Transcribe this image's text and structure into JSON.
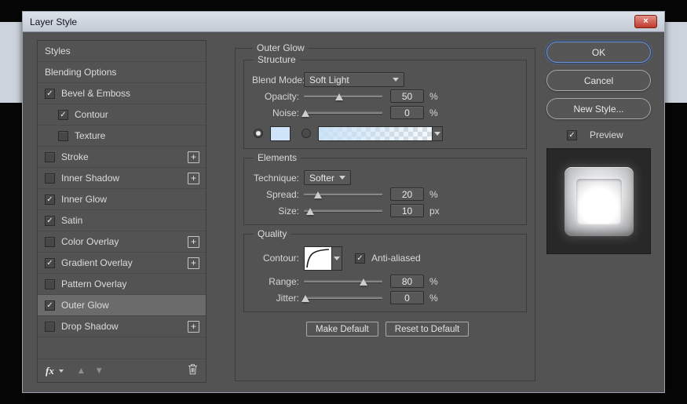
{
  "window": {
    "title": "Layer Style",
    "close_glyph": "×"
  },
  "colors": {
    "ok_focus_ring": "#6f94de",
    "glow_swatch": "#cfe4f8",
    "titlebar": "#c9d1db"
  },
  "sidebar": {
    "items": [
      {
        "label": "Styles",
        "checkbox": "none",
        "checked": false,
        "indent": false,
        "plus": false,
        "selected": false
      },
      {
        "label": "Blending Options",
        "checkbox": "none",
        "checked": false,
        "indent": false,
        "plus": false,
        "selected": false
      },
      {
        "label": "Bevel & Emboss",
        "checkbox": "box",
        "checked": true,
        "indent": false,
        "plus": false,
        "selected": false
      },
      {
        "label": "Contour",
        "checkbox": "box",
        "checked": true,
        "indent": true,
        "plus": false,
        "selected": false
      },
      {
        "label": "Texture",
        "checkbox": "box",
        "checked": false,
        "indent": true,
        "plus": false,
        "selected": false
      },
      {
        "label": "Stroke",
        "checkbox": "box",
        "checked": false,
        "indent": false,
        "plus": true,
        "selected": false
      },
      {
        "label": "Inner Shadow",
        "checkbox": "box",
        "checked": false,
        "indent": false,
        "plus": true,
        "selected": false
      },
      {
        "label": "Inner Glow",
        "checkbox": "box",
        "checked": true,
        "indent": false,
        "plus": false,
        "selected": false
      },
      {
        "label": "Satin",
        "checkbox": "box",
        "checked": true,
        "indent": false,
        "plus": false,
        "selected": false
      },
      {
        "label": "Color Overlay",
        "checkbox": "box",
        "checked": false,
        "indent": false,
        "plus": true,
        "selected": false
      },
      {
        "label": "Gradient Overlay",
        "checkbox": "box",
        "checked": true,
        "indent": false,
        "plus": true,
        "selected": false
      },
      {
        "label": "Pattern Overlay",
        "checkbox": "box",
        "checked": false,
        "indent": false,
        "plus": false,
        "selected": false
      },
      {
        "label": "Outer Glow",
        "checkbox": "box",
        "checked": true,
        "indent": false,
        "plus": false,
        "selected": true
      },
      {
        "label": "Drop Shadow",
        "checkbox": "box",
        "checked": false,
        "indent": false,
        "plus": true,
        "selected": false
      }
    ],
    "footer": {
      "fx_label": "fx",
      "up_glyph": "▲",
      "down_glyph": "▼"
    }
  },
  "panel": {
    "title": "Outer Glow",
    "structure": {
      "legend": "Structure",
      "blend_mode": {
        "label": "Blend Mode:",
        "value": "Soft Light"
      },
      "opacity": {
        "label": "Opacity:",
        "value": "50",
        "unit": "%",
        "pct": 45
      },
      "noise": {
        "label": "Noise:",
        "value": "0",
        "unit": "%",
        "pct": 2
      },
      "color_swatch": "#cfe4f8"
    },
    "elements": {
      "legend": "Elements",
      "technique": {
        "label": "Technique:",
        "value": "Softer"
      },
      "spread": {
        "label": "Spread:",
        "value": "20",
        "unit": "%",
        "pct": 18
      },
      "size": {
        "label": "Size:",
        "value": "10",
        "unit": "px",
        "pct": 8
      }
    },
    "quality": {
      "legend": "Quality",
      "contour_label": "Contour:",
      "anti_aliased": "Anti-aliased",
      "range": {
        "label": "Range:",
        "value": "80",
        "unit": "%",
        "pct": 76
      },
      "jitter": {
        "label": "Jitter:",
        "value": "0",
        "unit": "%",
        "pct": 2
      }
    },
    "footer_buttons": {
      "make_default": "Make Default",
      "reset_default": "Reset to Default"
    }
  },
  "actions": {
    "ok": "OK",
    "cancel": "Cancel",
    "new_style": "New Style...",
    "preview_label": "Preview"
  }
}
